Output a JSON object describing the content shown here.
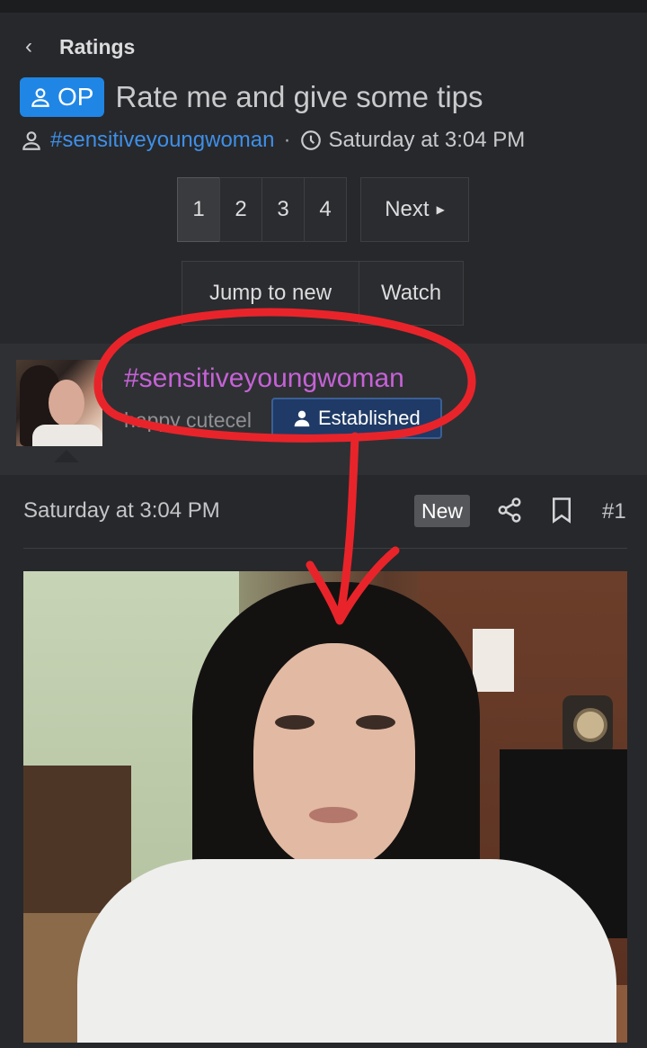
{
  "breadcrumb": {
    "back_icon": "chevron-left-icon",
    "label": "Ratings"
  },
  "thread": {
    "op_badge": "OP",
    "title": "Rate me and give some tips",
    "author": "#sensitiveyoungwoman",
    "separator": "·",
    "date": "Saturday at 3:04 PM"
  },
  "pagination": {
    "pages": [
      "1",
      "2",
      "3",
      "4"
    ],
    "active_page": "1",
    "next_label": "Next"
  },
  "actions": {
    "jump_label": "Jump to new",
    "watch_label": "Watch"
  },
  "poster": {
    "name": "#sensitiveyoungwoman",
    "user_title": "happy cutecel",
    "rank_badge": "Established",
    "name_color": "#c562d6"
  },
  "post": {
    "date": "Saturday at 3:04 PM",
    "new_badge": "New",
    "post_number": "#1",
    "share_icon": "share-icon",
    "bookmark_icon": "bookmark-icon"
  },
  "colors": {
    "accent": "#1f86e6",
    "link": "#3e8fe8",
    "annotation": "#e8242a",
    "badge_bg": "#1f3a66"
  }
}
